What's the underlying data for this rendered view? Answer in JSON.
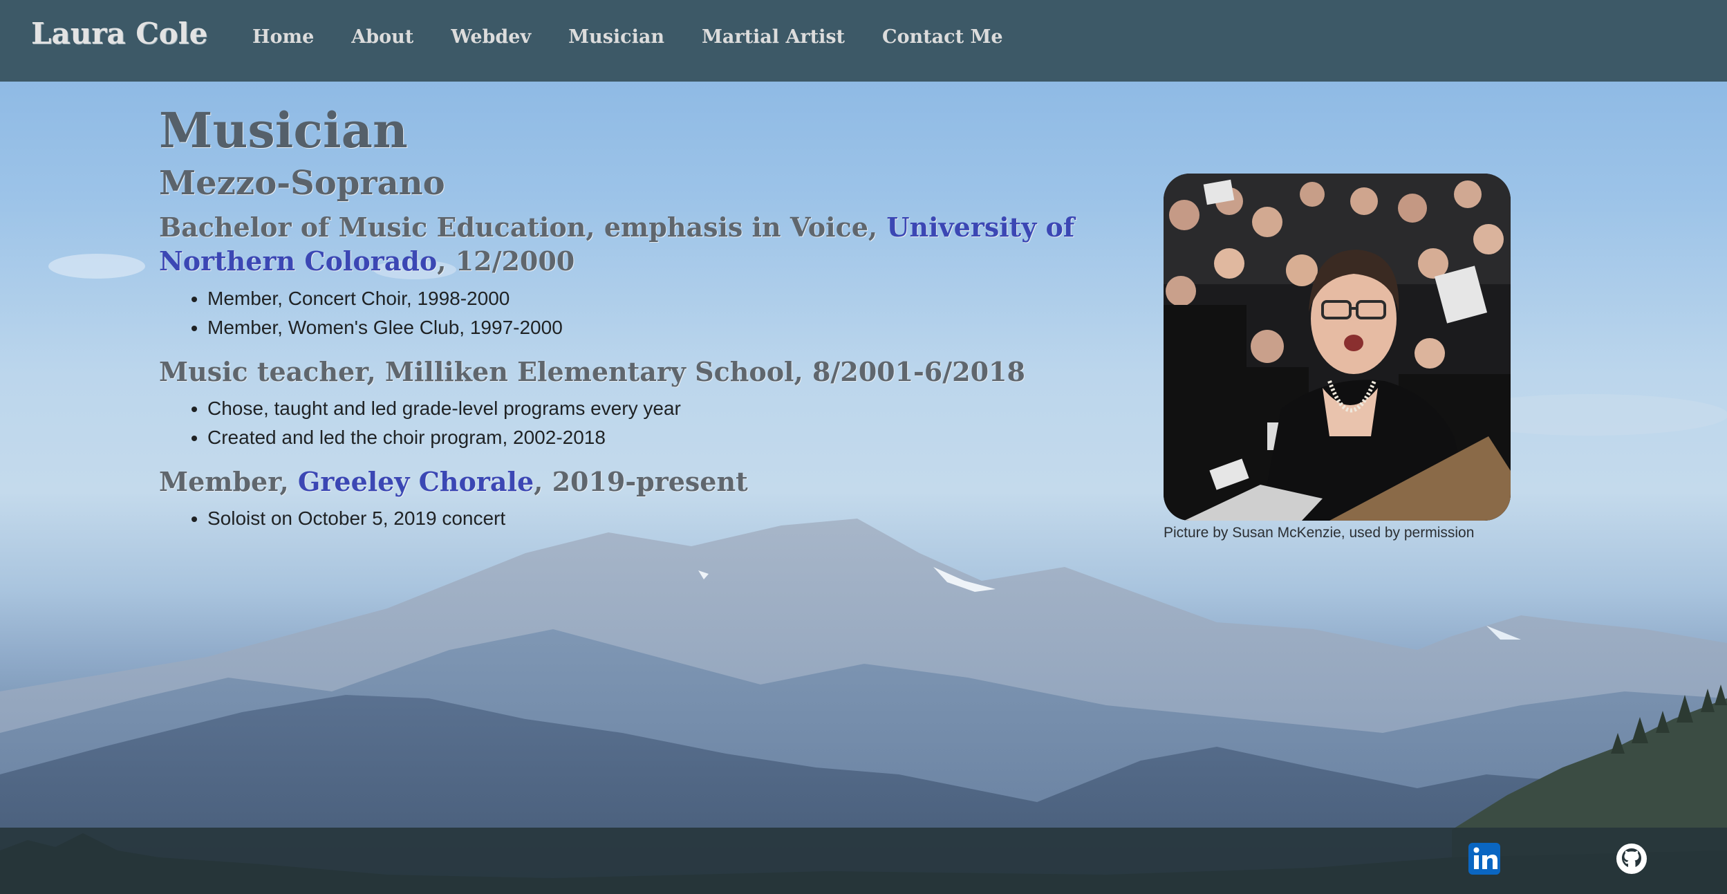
{
  "header": {
    "brand": "Laura Cole",
    "nav": [
      "Home",
      "About",
      "Webdev",
      "Musician",
      "Martial Artist",
      "Contact Me"
    ]
  },
  "main": {
    "title": "Musician",
    "subtitle": "Mezzo-Soprano",
    "sections": [
      {
        "prefix": "Bachelor of Music Education, emphasis in Voice, ",
        "link": "University of Northern Colorado",
        "suffix": ", 12/2000",
        "items": [
          "Member, Concert Choir, 1998-2000",
          "Member, Women's Glee Club, 1997-2000"
        ]
      },
      {
        "prefix": "Music teacher, Milliken Elementary School, 8/2001-6/2018",
        "link": "",
        "suffix": "",
        "items": [
          "Chose, taught and led grade-level programs every year",
          "Created and led the choir program, 2002-2018"
        ]
      },
      {
        "prefix": "Member, ",
        "link": "Greeley Chorale",
        "suffix": ", 2019-present",
        "items": [
          "Soloist on October 5, 2019 concert"
        ]
      }
    ],
    "photo_caption": "Picture by Susan McKenzie, used by permission"
  },
  "footer": {
    "icons": [
      "linkedin-icon",
      "github-icon"
    ]
  },
  "colors": {
    "header_bg": "#3d5967",
    "link": "#3b47b4",
    "footer_bg": "#26343a",
    "linkedin_blue": "#0a66c2"
  }
}
